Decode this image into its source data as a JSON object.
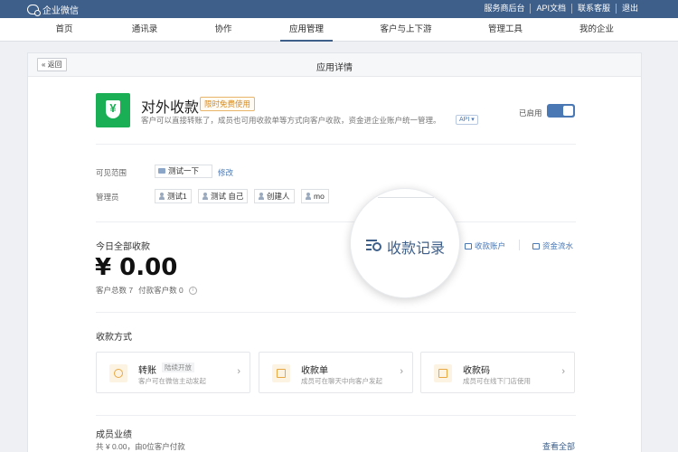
{
  "topbar": {
    "brand": "企业微信",
    "links": [
      "服务商后台",
      "API文档",
      "联系客服",
      "退出"
    ]
  },
  "nav": {
    "items": [
      "首页",
      "通讯录",
      "协作",
      "应用管理",
      "客户与上下游",
      "管理工具",
      "我的企业"
    ],
    "active": "应用管理"
  },
  "card": {
    "back_label": "« 返回",
    "title": "应用详情"
  },
  "app": {
    "name": "对外收款",
    "badge": "限时免费使用",
    "description": "客户可以直接转账了，成员也可用收款单等方式向客户收款，资金进企业账户统一管理。",
    "api_tag": "API ▾",
    "status_label": "已启用",
    "enabled": true
  },
  "visibility": {
    "label": "可见范围",
    "value": "测试一下",
    "edit": "修改"
  },
  "admins": {
    "label": "管理员",
    "items": [
      "测试1",
      "测试 自己",
      "创建人",
      "mo"
    ]
  },
  "today": {
    "label": "今日全部收款",
    "amount": "¥ 0.00",
    "customers": "客户总数 7",
    "paying": "付款客户数 0",
    "info_icon": "i"
  },
  "links": {
    "records": "收款记录",
    "account": "收款账户",
    "flow": "资金流水"
  },
  "methods": {
    "title": "收款方式",
    "items": [
      {
        "name": "转账",
        "tag": "陆续开放",
        "sub": "客户可在微信主动发起",
        "icon": "exchange-icon"
      },
      {
        "name": "收款单",
        "tag": "",
        "sub": "成员可在聊天中向客户发起",
        "icon": "yen-bill-icon"
      },
      {
        "name": "收款码",
        "tag": "",
        "sub": "成员可在线下门店使用",
        "icon": "qrcode-icon"
      }
    ]
  },
  "performance": {
    "title": "成员业绩",
    "summary": "共 ¥ 0.00，由0位客户付款",
    "view_all": "查看全部"
  },
  "colors": {
    "topbar": "#3e5f8a",
    "accent": "#4a78b5",
    "app_icon": "#1aae55",
    "badge": "#d48a1f"
  }
}
